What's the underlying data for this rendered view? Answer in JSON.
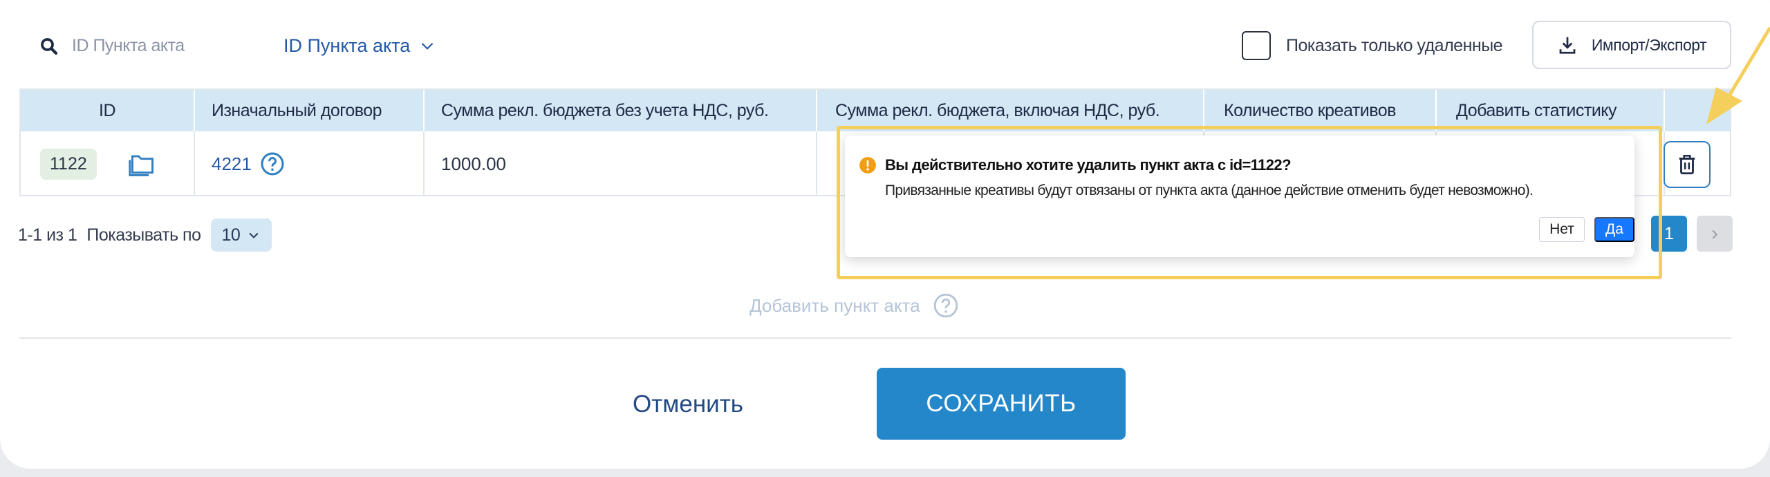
{
  "toolbar": {
    "search_placeholder": "ID Пункта акта",
    "search_field_label": "ID Пункта акта",
    "show_deleted_label": "Показать только удаленные",
    "import_export_label": "Импорт/Экспорт"
  },
  "table": {
    "columns": [
      "ID",
      "Изначальный договор",
      "Сумма рекл. бюджета без учета НДС, руб.",
      "Сумма рекл. бюджета, включая НДС, руб.",
      "Количество креативов",
      "Добавить статистику"
    ],
    "rows": [
      {
        "id": "1122",
        "contract": "4221",
        "budget_without_vat": "1000.00"
      }
    ]
  },
  "pagination": {
    "range_text": "1-1 из 1",
    "per_page_label": "Показывать по",
    "per_page_value": "10",
    "current_page": "1",
    "next_label": "›"
  },
  "add_item_label": "Добавить пункт акта",
  "actions": {
    "cancel_label": "Отменить",
    "save_label": "СОХРАНИТЬ"
  },
  "confirm_popover": {
    "title": "Вы действительно хотите удалить пункт акта с id=1122?",
    "description": "Привязанные креативы будут отвязаны от пункта акта (данное действие отменить будет невозможно).",
    "no_label": "Нет",
    "yes_label": "Да"
  },
  "colors": {
    "header_bg": "#d4e7f5",
    "primary": "#2487c9",
    "link": "#2559a8",
    "highlight": "#f5cf5b",
    "confirm_yes": "#1677ff",
    "warning": "#f29d13"
  },
  "icons": [
    "search-icon",
    "chevron-down-icon",
    "download-icon",
    "folder-icon",
    "help-icon",
    "trash-icon",
    "warning-icon",
    "arrow-annotation-icon"
  ]
}
